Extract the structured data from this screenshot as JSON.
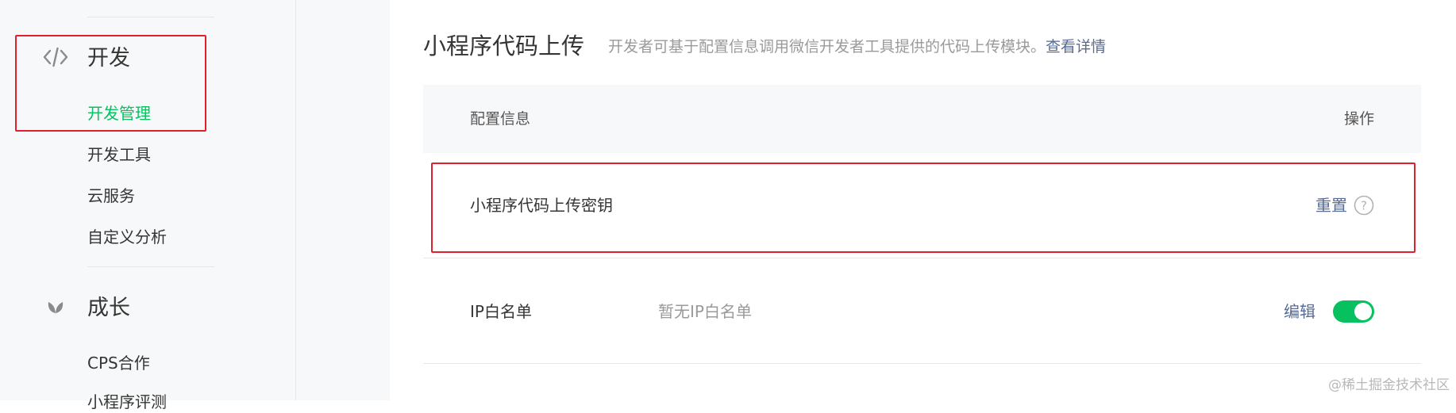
{
  "sidebar": {
    "sections": [
      {
        "icon": "code-icon",
        "title": "开发",
        "items": [
          {
            "label": "开发管理",
            "active": true
          },
          {
            "label": "开发工具",
            "active": false
          },
          {
            "label": "云服务",
            "active": false
          },
          {
            "label": "自定义分析",
            "active": false
          }
        ]
      },
      {
        "icon": "sprout-icon",
        "title": "成长",
        "items": [
          {
            "label": "CPS合作",
            "active": false
          },
          {
            "label": "小程序评测",
            "active": false
          }
        ]
      }
    ]
  },
  "main": {
    "title": "小程序代码上传",
    "description": "开发者可基于配置信息调用微信开发者工具提供的代码上传模块。",
    "description_link": "查看详情",
    "table": {
      "header_config": "配置信息",
      "header_ops": "操作",
      "rows": [
        {
          "label": "小程序代码上传密钥",
          "value": "",
          "action": "重置"
        },
        {
          "label": "IP白名单",
          "value": "暂无IP白名单",
          "action": "编辑",
          "toggle_on": true
        }
      ]
    }
  },
  "watermark": "@稀土掘金技术社区",
  "colors": {
    "accent_green": "#07c160",
    "link_blue": "#576b95",
    "highlight_red": "#e0202f"
  }
}
